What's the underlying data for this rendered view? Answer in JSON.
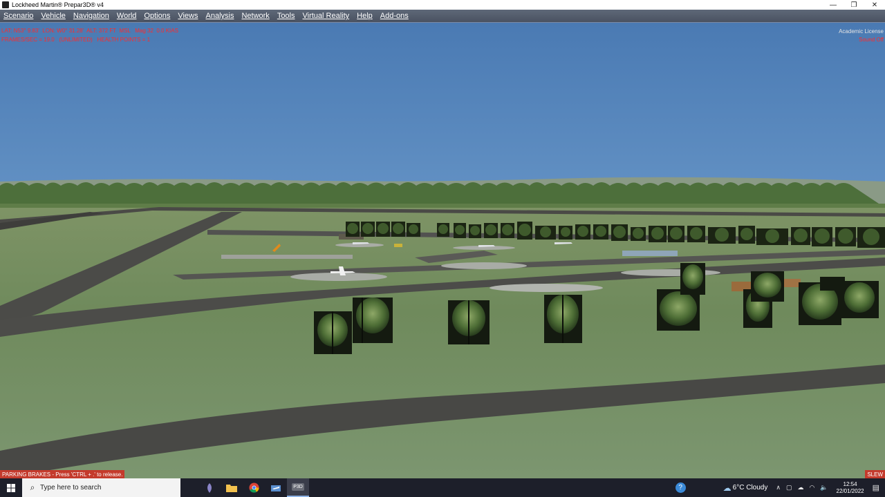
{
  "window": {
    "title": "Lockheed Martin® Prepar3D® v4",
    "minimize_glyph": "—",
    "maximize_glyph": "❐",
    "close_glyph": "✕"
  },
  "menu": [
    "Scenario",
    "Vehicle",
    "Navigation",
    "World",
    "Options",
    "Views",
    "Analysis",
    "Network",
    "Tools",
    "Virtual Reality",
    "Help",
    "Add-ons"
  ],
  "hud": {
    "line1": "LAT: N53° 9.83'  LON: W0° 31.28'  ALT: 372 FT  MSL   Mag 32  0.0 KIAS",
    "line2": "FRAMES/SEC = 19.0   (UNLIMITED)   HEALTH POINTS = 1",
    "license": "Academic License",
    "sound": "Sound Off"
  },
  "status": {
    "left": "PARKING BRAKES - Press 'CTRL + .' to release.",
    "right": "SLEW"
  },
  "taskbar": {
    "search_placeholder": "Type here to search",
    "p3d_label": "P3D",
    "weather": "6°C  Cloudy",
    "time": "12:54",
    "date": "22/01/2022"
  },
  "colors": {
    "hud_red": "#ff2a2a",
    "status_red": "#c43a2c",
    "taskbar": "#1d1f2a"
  }
}
